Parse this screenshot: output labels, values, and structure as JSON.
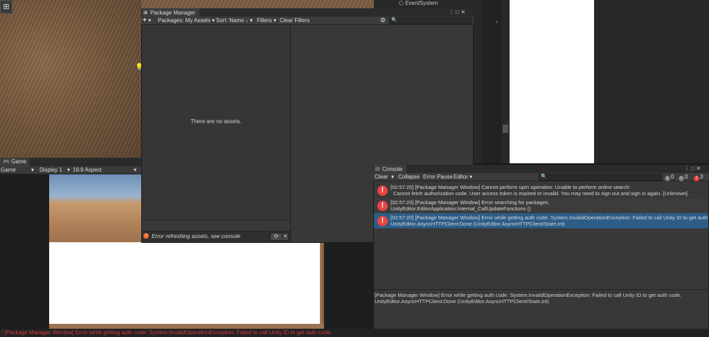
{
  "scene": {
    "tool_icon": "grid-icon",
    "hierarchy_item": "EventSystem",
    "hierarchy_icon": "cube-icon"
  },
  "game": {
    "tab_label": "Game",
    "mode_dropdown": "Game",
    "display_dropdown": "Display 1",
    "aspect_dropdown": "16:9 Aspect"
  },
  "package_manager": {
    "title": "Package Manager",
    "add_label": "+",
    "packages_dropdown": "Packages: My Assets",
    "sort_dropdown": "Sort: Name ↓",
    "filters_dropdown": "Filters",
    "clear_filters": "Clear Filters",
    "empty_message": "There are no assets.",
    "status_message": "Error refreshing assets, see console"
  },
  "console": {
    "title": "Console",
    "clear_label": "Clear",
    "collapse_label": "Collapse",
    "error_pause_label": "Error Pause",
    "editor_dropdown": "Editor",
    "counts": {
      "info": "0",
      "warnings": "0",
      "errors": "3"
    },
    "entries": [
      {
        "line1": "[02:57:20] [Package Manager Window] Cannot perform upm operation: Unable to perform online search:",
        "line2": "Cannot fetch authorization code. User access token is expired or invalid. You may need to sign out and sign in again. [Unknown]."
      },
      {
        "line1": "[02:57:20] [Package Manager Window] Error searching for packages.",
        "line2": "UnityEditor.EditorApplication:Internal_CallUpdateFunctions ()"
      },
      {
        "line1": "[02:57:20] [Package Manager Window] Error while getting auth code: System.InvalidOperationException: Failed to call Unity ID to get auth",
        "line2": "UnityEditor.AsyncHTTPClient:Done (UnityEditor.AsyncHTTPClient/State,int)"
      }
    ],
    "detail_line1": "[Package Manager Window] Error while getting auth code: System.InvalidOperationException: Failed to call Unity ID to get auth code.",
    "detail_line2": "UnityEditor.AsyncHTTPClient:Done (UnityEditor.AsyncHTTPClient/State,int)"
  },
  "status_bar": {
    "message": "[Package Manager Window] Error while getting auth code: System.InvalidOperationException: Failed to call Unity ID to get auth code."
  },
  "colors": {
    "error": "#e84444",
    "selection": "#2c5d87",
    "status_text": "#d43b3b"
  }
}
